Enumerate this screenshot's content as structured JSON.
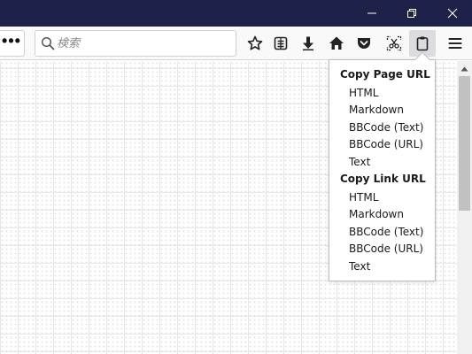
{
  "window_controls": {
    "minimize": "minimize-icon",
    "restore": "restore-icon",
    "close": "close-icon"
  },
  "toolbar": {
    "overflow_label": "•••",
    "search": {
      "placeholder": "検索",
      "value": ""
    },
    "icons": [
      "star-icon",
      "reader-list-icon",
      "download-icon",
      "home-icon",
      "pocket-icon",
      "screenshot-icon",
      "clipboard-icon",
      "hamburger-menu-icon"
    ]
  },
  "popup": {
    "groups": [
      {
        "title": "Copy Page URL",
        "items": [
          "HTML",
          "Markdown",
          "BBCode (Text)",
          "BBCode (URL)",
          "Text"
        ]
      },
      {
        "title": "Copy Link URL",
        "items": [
          "HTML",
          "Markdown",
          "BBCode (Text)",
          "BBCode (URL)",
          "Text"
        ]
      }
    ]
  },
  "colors": {
    "titlebar": "#1e2249",
    "toolbar": "#f9f9fa",
    "active_button": "#dcdcdf"
  }
}
